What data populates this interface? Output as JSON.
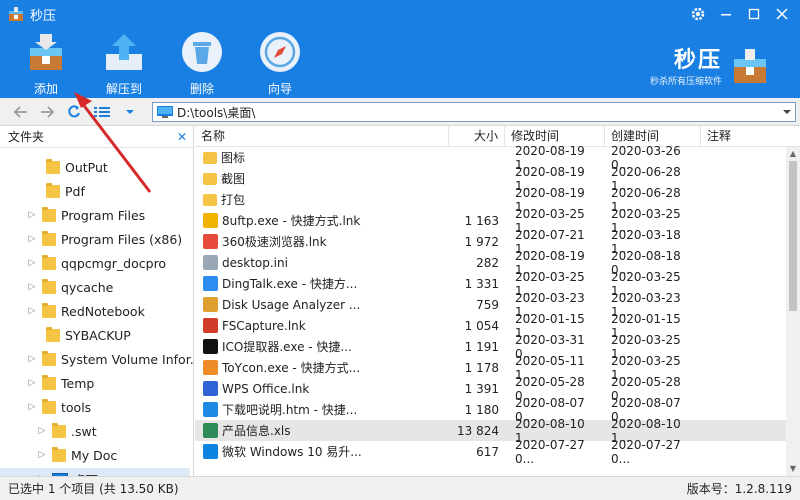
{
  "app": {
    "title": "秒压"
  },
  "toolbar": {
    "add": "添加",
    "extract": "解压到",
    "delete": "删除",
    "wizard": "向导"
  },
  "brand": {
    "title": "秒压",
    "subtitle": "秒杀所有压缩软件"
  },
  "address": {
    "path": "D:\\tools\\桌面\\"
  },
  "tree": {
    "header": "文件夹",
    "items": [
      {
        "label": "OutPut",
        "expandable": false
      },
      {
        "label": "Pdf",
        "expandable": false
      },
      {
        "label": "Program Files",
        "expandable": true
      },
      {
        "label": "Program Files (x86)",
        "expandable": true
      },
      {
        "label": "qqpcmgr_docpro",
        "expandable": true
      },
      {
        "label": "qycache",
        "expandable": true
      },
      {
        "label": "RedNotebook",
        "expandable": true
      },
      {
        "label": "SYBACKUP",
        "expandable": false
      },
      {
        "label": "System Volume Infor...",
        "expandable": true
      },
      {
        "label": "Temp",
        "expandable": true
      },
      {
        "label": "tools",
        "expandable": true
      },
      {
        "label": ".swt",
        "expandable": true
      },
      {
        "label": "My Doc",
        "expandable": true
      },
      {
        "label": "桌面",
        "expandable": true
      }
    ]
  },
  "files": {
    "columns": {
      "name": "名称",
      "size": "大小",
      "modified": "修改时间",
      "created": "创建时间",
      "note": "注释"
    },
    "rows": [
      {
        "name": "图标",
        "size": "",
        "modified": "2020-08-19 1...",
        "created": "2020-03-26 0...",
        "icon": "folder-icon",
        "color": "#f6c445"
      },
      {
        "name": "截图",
        "size": "",
        "modified": "2020-08-19 1...",
        "created": "2020-06-28 1...",
        "icon": "folder-icon",
        "color": "#f6c445"
      },
      {
        "name": "打包",
        "size": "",
        "modified": "2020-08-19 1...",
        "created": "2020-06-28 1...",
        "icon": "folder-icon",
        "color": "#f6c445"
      },
      {
        "name": "8uftp.exe - 快捷方式.lnk",
        "size": "1 163",
        "modified": "2020-03-25 1...",
        "created": "2020-03-25 1...",
        "icon": "ftp-icon",
        "color": "#f0b400"
      },
      {
        "name": "360极速浏览器.lnk",
        "size": "1 972",
        "modified": "2020-07-21 1...",
        "created": "2020-03-18 1...",
        "icon": "browser-icon",
        "color": "#e84a3c"
      },
      {
        "name": "desktop.ini",
        "size": "282",
        "modified": "2020-08-19 1...",
        "created": "2020-08-18 0...",
        "icon": "ini-file-icon",
        "color": "#9aa7b5"
      },
      {
        "name": "DingTalk.exe - 快捷方...",
        "size": "1 331",
        "modified": "2020-03-25 1...",
        "created": "2020-03-25 1...",
        "icon": "dingtalk-icon",
        "color": "#2d8cf0"
      },
      {
        "name": "Disk Usage Analyzer ...",
        "size": "759",
        "modified": "2020-03-23 1...",
        "created": "2020-03-23 1...",
        "icon": "disk-icon",
        "color": "#e0a030"
      },
      {
        "name": "FSCapture.lnk",
        "size": "1 054",
        "modified": "2020-01-15 1...",
        "created": "2020-01-15 1...",
        "icon": "capture-icon",
        "color": "#d23b2a"
      },
      {
        "name": "ICO提取器.exe - 快捷...",
        "size": "1 191",
        "modified": "2020-03-31 0...",
        "created": "2020-03-25 1...",
        "icon": "ico-extractor-icon",
        "color": "#111111"
      },
      {
        "name": "ToYcon.exe - 快捷方式...",
        "size": "1 178",
        "modified": "2020-05-11 1...",
        "created": "2020-03-25 1...",
        "icon": "toycon-icon",
        "color": "#f08c28"
      },
      {
        "name": "WPS Office.lnk",
        "size": "1 391",
        "modified": "2020-05-28 0...",
        "created": "2020-05-28 0...",
        "icon": "wps-icon",
        "color": "#2f63d6"
      },
      {
        "name": "下载吧说明.htm - 快捷...",
        "size": "1 180",
        "modified": "2020-08-07 0...",
        "created": "2020-08-07 0...",
        "icon": "ie-icon",
        "color": "#1e88e5"
      },
      {
        "name": "产品信息.xls",
        "size": "13 824",
        "modified": "2020-08-10 1...",
        "created": "2020-08-10 1...",
        "icon": "xls-icon",
        "color": "#2e8b57"
      },
      {
        "name": "微软 Windows 10 易升...",
        "size": "617",
        "modified": "2020-07-27 0...",
        "created": "2020-07-27 0...",
        "icon": "windows-icon",
        "color": "#0a84e0"
      }
    ]
  },
  "status": {
    "selection": "已选中 1 个项目 (共 13.50 KB)",
    "version": "版本号：1.2.8.119"
  },
  "colors": {
    "accent": "#1a7fe3",
    "annotation": "#d62a2a"
  }
}
